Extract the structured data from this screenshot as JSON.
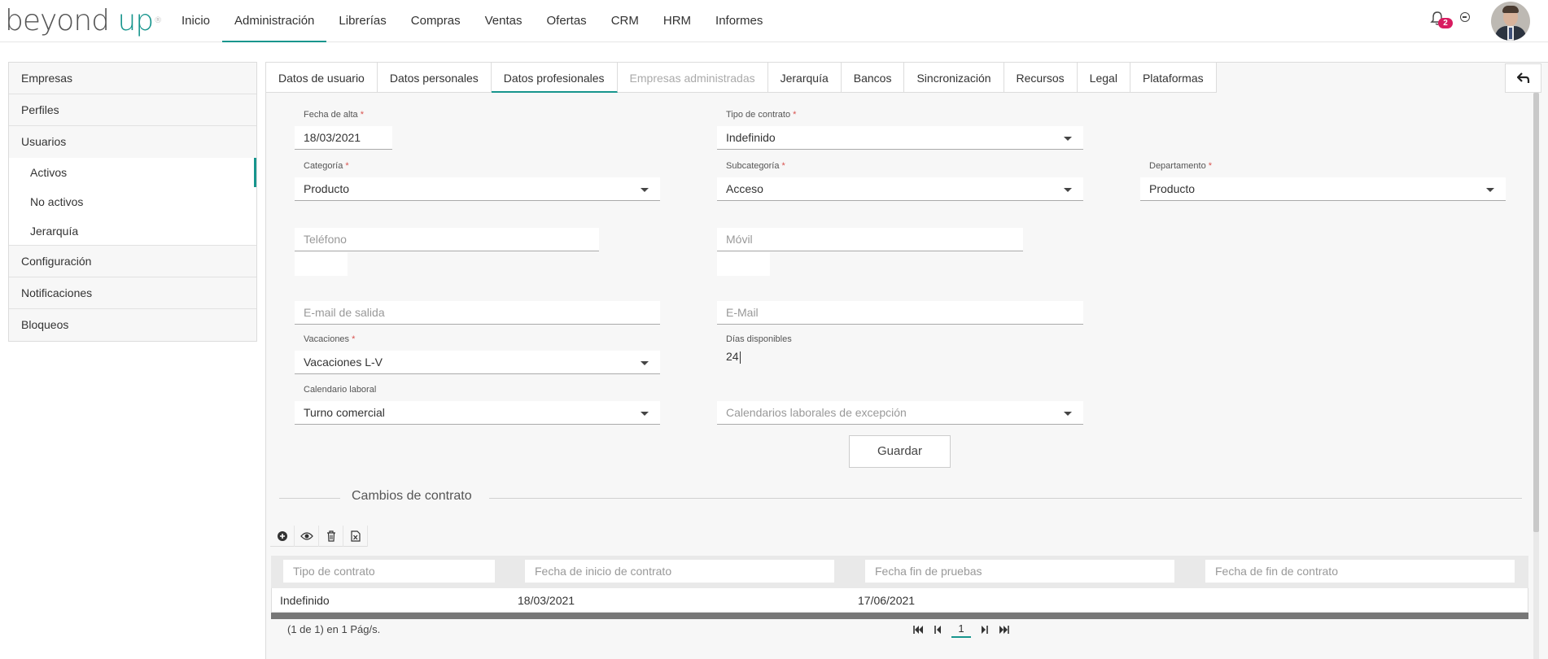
{
  "brand": {
    "text_beyond": "beyond",
    "text_up": "up",
    "mark": "®"
  },
  "nav": {
    "items": [
      "Inicio",
      "Administración",
      "Librerías",
      "Compras",
      "Ventas",
      "Ofertas",
      "CRM",
      "HRM",
      "Informes"
    ],
    "active": "Administración"
  },
  "header": {
    "notification_count": "2",
    "icons": [
      "bell-icon",
      "circle-minus-icon",
      "user-avatar"
    ]
  },
  "sidebar": {
    "items": [
      "Empresas",
      "Perfiles",
      "Usuarios",
      "Configuración",
      "Notificaciones",
      "Bloqueos"
    ],
    "usuarios_sub": [
      "Activos",
      "No activos",
      "Jerarquía"
    ],
    "active_sub": "Activos"
  },
  "tabs": {
    "items": [
      "Datos de usuario",
      "Datos personales",
      "Datos profesionales",
      "Empresas administradas",
      "Jerarquía",
      "Bancos",
      "Sincronización",
      "Recursos",
      "Legal",
      "Plataformas"
    ],
    "active": "Datos profesionales",
    "disabled": "Empresas administradas"
  },
  "form": {
    "fecha_alta": {
      "label": "Fecha de alta",
      "required": "*",
      "value": "18/03/2021"
    },
    "tipo_contrato": {
      "label": "Tipo de contrato",
      "required": "*",
      "value": "Indefinido"
    },
    "categoria": {
      "label": "Categoría",
      "required": "*",
      "value": "Producto"
    },
    "subcategoria": {
      "label": "Subcategoría",
      "required": "*",
      "value": "Acceso"
    },
    "departamento": {
      "label": "Departamento",
      "required": "*",
      "value": "Producto"
    },
    "telefono": {
      "placeholder": "Teléfono"
    },
    "movil": {
      "placeholder": "Móvil"
    },
    "email_salida": {
      "placeholder": "E-mail de salida"
    },
    "email": {
      "placeholder": "E-Mail"
    },
    "vacaciones": {
      "label": "Vacaciones",
      "required": "*",
      "value": "Vacaciones L-V"
    },
    "dias_disponibles": {
      "label": "Días disponibles",
      "value": "24"
    },
    "calendario_laboral": {
      "label": "Calendario laboral",
      "value": "Turno comercial"
    },
    "calendarios_excepcion": {
      "placeholder": "Calendarios laborales de excepción"
    },
    "save_label": "Guardar"
  },
  "contract_changes": {
    "title": "Cambios de contrato",
    "toolbar": [
      "plus-circle-icon",
      "eye-icon",
      "trash-icon",
      "excel-icon"
    ],
    "filters": [
      "Tipo de contrato",
      "Fecha de inicio de contrato",
      "Fecha fin de pruebas",
      "Fecha de fin de contrato"
    ],
    "rows": [
      {
        "tipo": "Indefinido",
        "inicio": "18/03/2021",
        "fin_pruebas": "17/06/2021",
        "fin_contrato": ""
      }
    ],
    "pager_info": "(1 de 1) en 1 Pág/s.",
    "current_page": "1"
  }
}
